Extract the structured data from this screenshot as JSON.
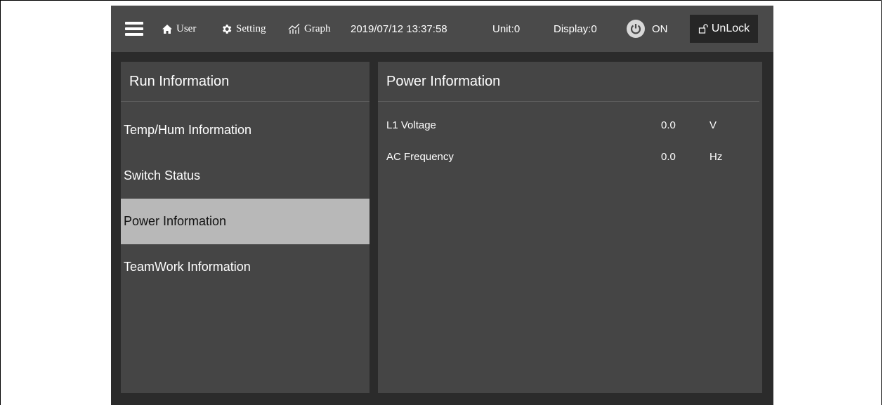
{
  "topbar": {
    "user_label": "User",
    "setting_label": "Setting",
    "graph_label": "Graph",
    "datetime": "2019/07/12 13:37:58",
    "unit": "Unit:0",
    "display": "Display:0",
    "power_state": "ON",
    "lock_label": "UnLock"
  },
  "left_panel": {
    "title": "Run Information",
    "items": [
      {
        "label": "Temp/Hum Information",
        "selected": false
      },
      {
        "label": "Switch Status",
        "selected": false
      },
      {
        "label": "Power Information",
        "selected": true
      },
      {
        "label": "TeamWork Information",
        "selected": false
      }
    ]
  },
  "right_panel": {
    "title": "Power Information",
    "rows": [
      {
        "label": "L1 Voltage",
        "value": "0.0",
        "unit": "V"
      },
      {
        "label": "AC Frequency",
        "value": "0.0",
        "unit": "Hz"
      }
    ]
  },
  "colors": {
    "topbar_bg": "#4a4a4a",
    "panel_bg": "#454545",
    "selected_bg": "#b8b8b8",
    "device_bg": "#2b2b2b"
  },
  "icons": [
    "menu-icon",
    "home-icon",
    "gear-icon",
    "graph-icon",
    "power-icon",
    "unlock-icon"
  ]
}
